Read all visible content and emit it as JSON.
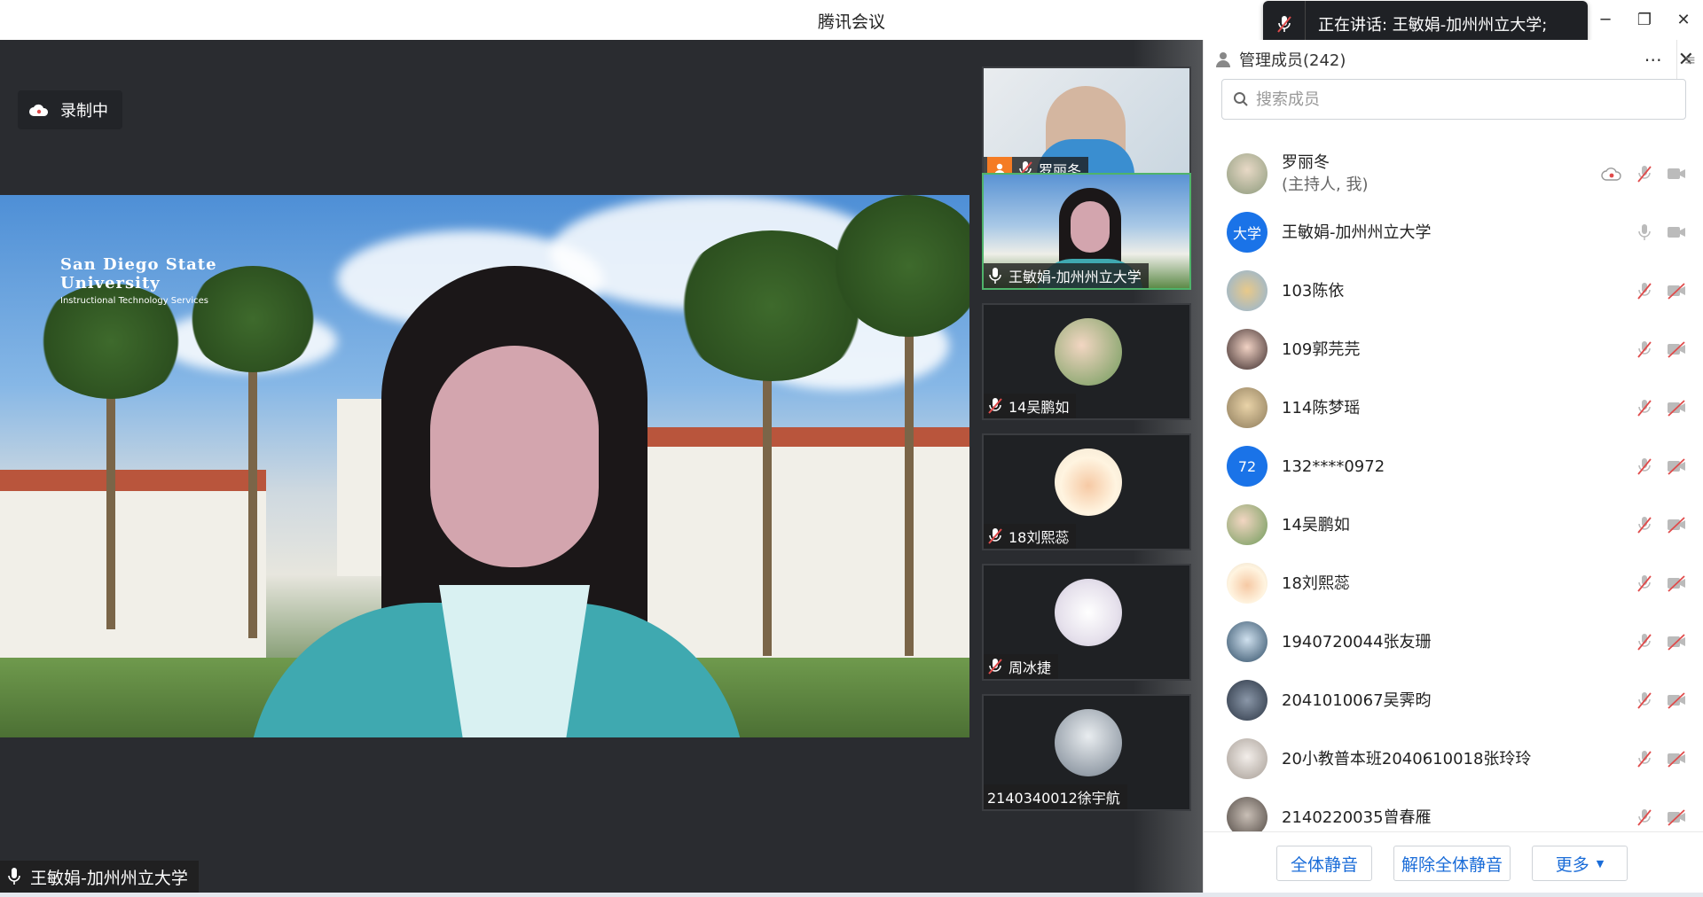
{
  "window": {
    "title": "腾讯会议"
  },
  "speaking": {
    "text": "正在讲话: 王敏娟-加州州立大学;"
  },
  "recording": {
    "label": "录制中"
  },
  "main_video": {
    "speaker_name": "王敏娟-加州州立大学",
    "logo_line1": "San Diego State",
    "logo_line2": "University",
    "logo_line3": "Instructional Technology Services"
  },
  "tiles": [
    {
      "name": "罗丽冬",
      "host": true,
      "muted": true,
      "avatar_color": "#c9b9a8"
    },
    {
      "name": "王敏娟-加州州立大学",
      "active": true,
      "muted": false,
      "avatar_color": "#6fa0d0"
    },
    {
      "name": "14吴鹏如",
      "muted": true,
      "avatar_color": "#8aa37a"
    },
    {
      "name": "18刘熙蕊",
      "muted": true,
      "avatar_color": "#f3d9a8"
    },
    {
      "name": "周冰捷",
      "muted": true,
      "avatar_color": "#e8e3ef"
    },
    {
      "name": "2140340012徐宇航",
      "muted": false,
      "noicon": true,
      "avatar_color": "#9aa3ad"
    }
  ],
  "panel": {
    "title": "管理成员(242)",
    "search_placeholder": "搜索成员",
    "members": [
      {
        "name": "罗丽冬",
        "sub": "(主持人, 我)",
        "avatar": "",
        "color": "#9a8f7e"
      },
      {
        "name": "王敏娟-加州州立大学",
        "avatar": "大学",
        "color": "#1a73e8"
      },
      {
        "name": "103陈依",
        "avatar": "",
        "color": "#c8a66a"
      },
      {
        "name": "109郭芫芫",
        "avatar": "",
        "color": "#4b3a3a"
      },
      {
        "name": "114陈梦瑶",
        "avatar": "",
        "color": "#cbb48a"
      },
      {
        "name": "132****0972",
        "avatar": "72",
        "color": "#1a73e8"
      },
      {
        "name": "14吴鹏如",
        "avatar": "",
        "color": "#8aa37a"
      },
      {
        "name": "18刘熙蕊",
        "avatar": "",
        "color": "#f3d9a8"
      },
      {
        "name": "1940720044张友珊",
        "avatar": "",
        "color": "#5b7a93"
      },
      {
        "name": "2041010067吴霁昀",
        "avatar": "",
        "color": "#3d4a5c"
      },
      {
        "name": "20小教普本班2040610018张玲玲",
        "avatar": "",
        "color": "#d8d4d0"
      },
      {
        "name": "2140220035曾春雁",
        "avatar": "",
        "color": "#6d6560"
      }
    ],
    "buttons": {
      "mute_all": "全体静音",
      "unmute_all": "解除全体静音",
      "more": "更多"
    }
  },
  "colors": {
    "accent": "#1a73e8",
    "muted_red": "#e04b4b",
    "active_border": "#4fb36a",
    "host_orange": "#f57c24"
  }
}
